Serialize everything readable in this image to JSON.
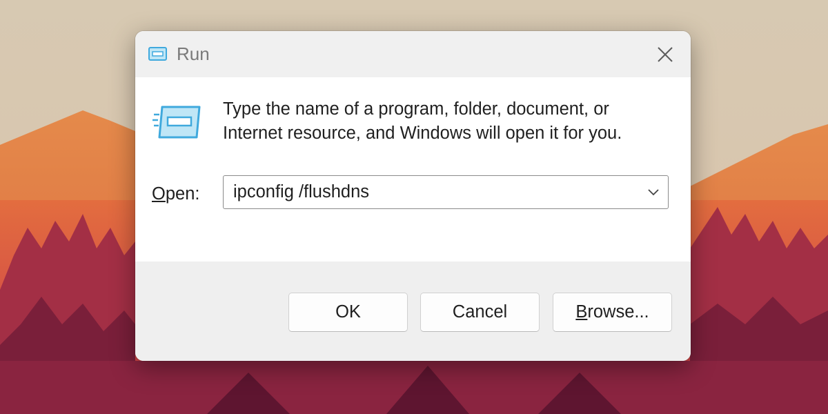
{
  "window": {
    "title": "Run",
    "close_icon": "close-icon"
  },
  "body": {
    "description_line1": "Type the name of a program, folder, document, or",
    "description_line2": "Internet resource, and Windows will open it for you.",
    "open_label_accel": "O",
    "open_label_rest": "pen:",
    "command_value": "ipconfig /flushdns",
    "dropdown_icon": "chevron-down-icon"
  },
  "buttons": {
    "ok_label": "OK",
    "cancel_label": "Cancel",
    "browse_accel": "B",
    "browse_rest": "rowse..."
  },
  "colors": {
    "accent": "#3fa9dd",
    "titlebar": "#f0f0f0",
    "footer": "#efefef"
  }
}
